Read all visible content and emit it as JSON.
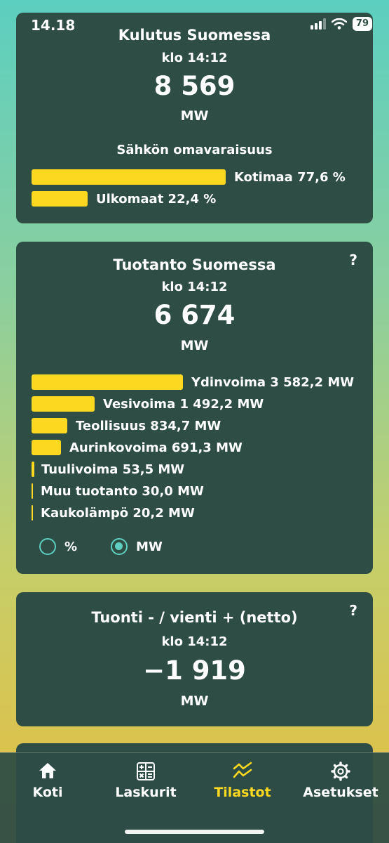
{
  "status": {
    "time": "14.18",
    "battery": "79"
  },
  "consumption": {
    "title": "Kulutus Suomessa",
    "time": "klo 14:12",
    "value": "8 569",
    "unit": "MW",
    "self_sufficiency_title": "Sähkön omavaraisuus",
    "rows": [
      {
        "label": "Kotimaa 77,6 %",
        "percent": 77.6
      },
      {
        "label": "Ulkomaat 22,4 %",
        "percent": 22.4
      }
    ]
  },
  "production": {
    "title": "Tuotanto Suomessa",
    "help": "?",
    "time": "klo 14:12",
    "value": "6 674",
    "unit": "MW",
    "rows": [
      {
        "label": "Ydinvoima 3 582,2 MW",
        "mw": 3582.2
      },
      {
        "label": "Vesivoima 1 492,2 MW",
        "mw": 1492.2
      },
      {
        "label": "Teollisuus 834,7 MW",
        "mw": 834.7
      },
      {
        "label": "Aurinkovoima 691,3 MW",
        "mw": 691.3
      },
      {
        "label": "Tuulivoima 53,5 MW",
        "mw": 53.5
      },
      {
        "label": "Muu tuotanto 30,0 MW",
        "mw": 30.0
      },
      {
        "label": "Kaukolämpö 20,2 MW",
        "mw": 20.2
      }
    ],
    "unit_options": [
      {
        "label": "%",
        "selected": false
      },
      {
        "label": "MW",
        "selected": true
      }
    ]
  },
  "import_export": {
    "title": "Tuonti - / vienti + (netto)",
    "help": "?",
    "time": "klo 14:12",
    "value": "−1 919",
    "unit": "MW"
  },
  "tabbar": {
    "tabs": [
      {
        "label": "Koti",
        "icon": "home-icon",
        "active": false
      },
      {
        "label": "Laskurit",
        "icon": "calculator-icon",
        "active": false
      },
      {
        "label": "Tilastot",
        "icon": "chart-icon",
        "active": true
      },
      {
        "label": "Asetukset",
        "icon": "gear-icon",
        "active": false
      }
    ]
  },
  "colors": {
    "card": "#2d4d45",
    "bar": "#fdd820",
    "accent": "#5ecfc0"
  }
}
